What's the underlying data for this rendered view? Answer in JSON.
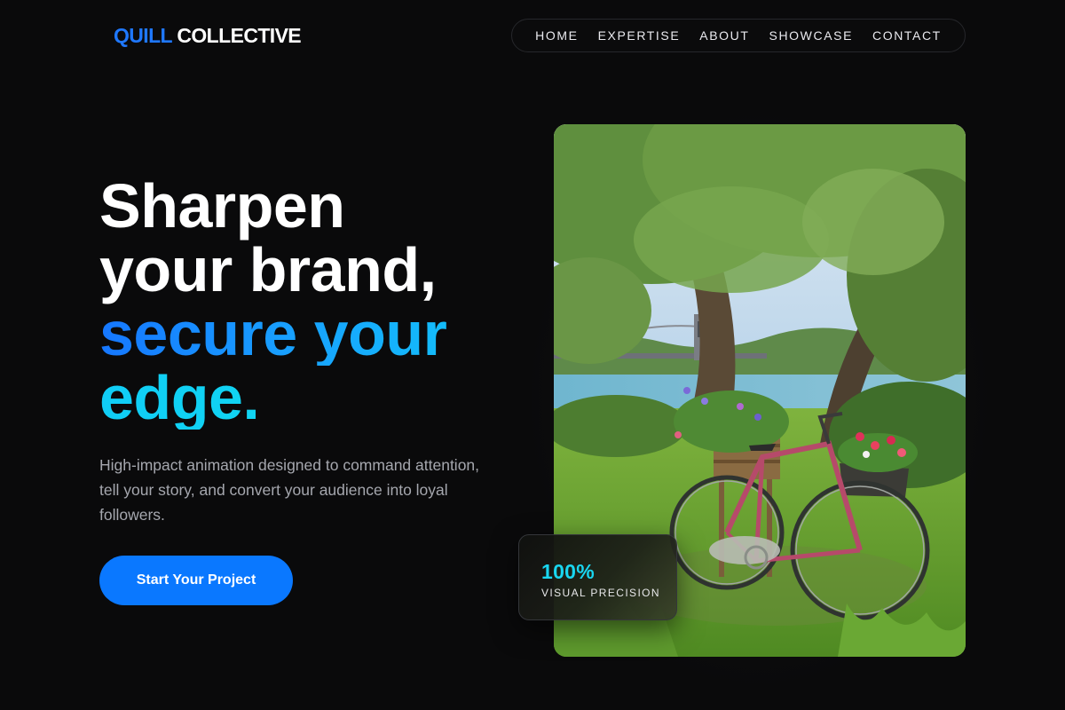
{
  "brand": {
    "part1": "QUILL",
    "part2": "COLLECTIVE"
  },
  "nav": {
    "items": [
      "HOME",
      "EXPERTISE",
      "ABOUT",
      "SHOWCASE",
      "CONTACT"
    ]
  },
  "hero": {
    "line1": "Sharpen",
    "line2": "your brand,",
    "line3": "secure your",
    "line4": "edge.",
    "subtext": "High-impact animation designed to command attention, tell your story, and convert your audience into loyal followers.",
    "cta_label": "Start Your Project"
  },
  "stat": {
    "value": "100%",
    "label": "VISUAL PRECISION"
  },
  "image": {
    "subject": "bicycle-with-flower-baskets-under-tree-by-river"
  },
  "colors": {
    "background": "#0a0a0b",
    "accent": "#0a78ff",
    "brand_blue": "#1f78ff",
    "cyan": "#19d6f0",
    "muted_text": "#a5a7ae"
  }
}
